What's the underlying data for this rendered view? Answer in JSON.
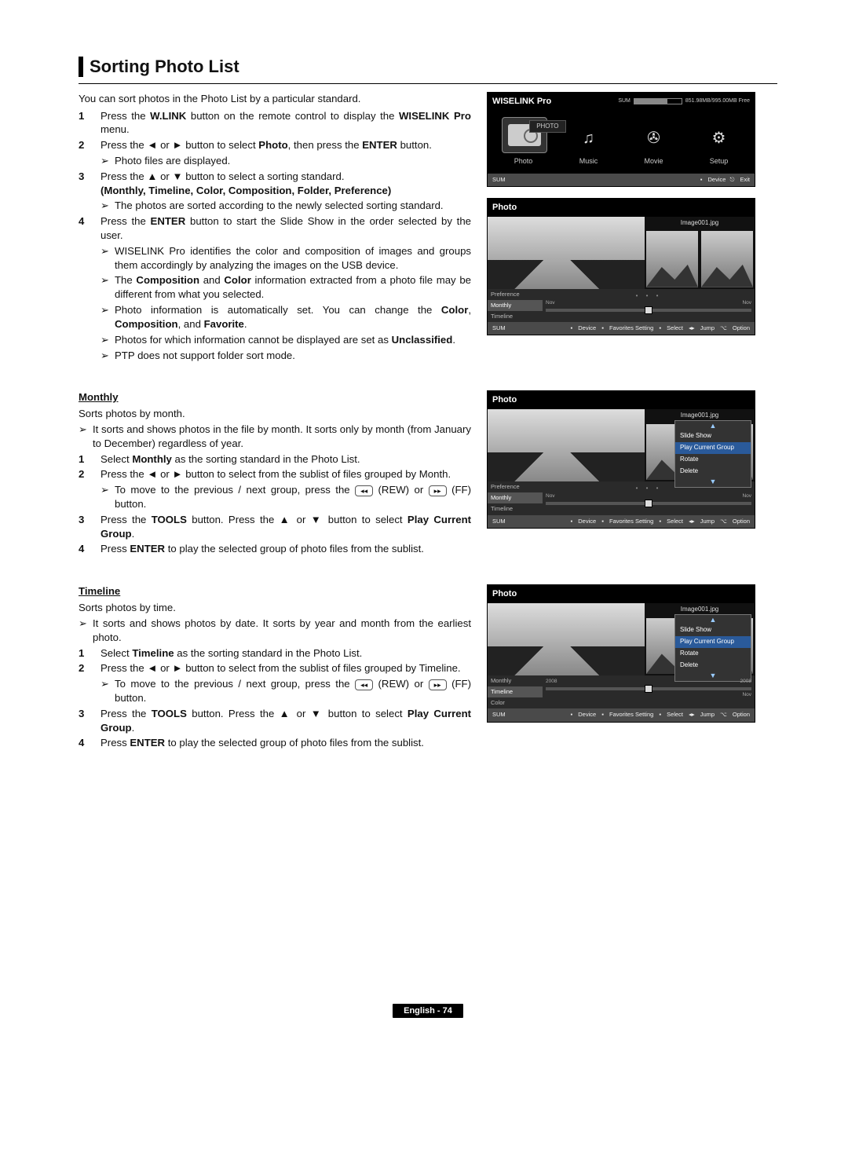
{
  "title": "Sorting Photo List",
  "intro": "You can sort photos in the Photo List by a particular standard.",
  "step1": {
    "num": "1",
    "a": "Press the ",
    "b": "W.LINK",
    "c": " button on the remote control to display the ",
    "d": "WISELINK Pro",
    "e": " menu."
  },
  "step2": {
    "num": "2",
    "a": "Press the ◄ or ► button to select ",
    "b": "Photo",
    "c": ", then press the ",
    "d": "ENTER",
    "e": " button."
  },
  "step2_note": "Photo files are displayed.",
  "step3": {
    "num": "3",
    "a": "Press the ▲ or ▼ button to select a sorting standard.",
    "b": "(Monthly, Timeline, Color, Composition, Folder, Preference)"
  },
  "step3_note": "The photos are sorted according to the newly selected sorting standard.",
  "step4": {
    "num": "4",
    "a": "Press the ",
    "b": "ENTER",
    "c": " button to start the Slide Show in the order selected by the user."
  },
  "step4_notes": {
    "n1": "WISELINK Pro identifies the color and composition of images and groups them accordingly by analyzing the images on the USB device.",
    "n2a": "The ",
    "n2b": "Composition",
    "n2c": " and ",
    "n2d": "Color",
    "n2e": " information extracted from a photo file may be different from what you selected.",
    "n3a": "Photo information is automatically set. You can change the ",
    "n3b": "Color",
    "n3c": ", ",
    "n3d": "Composition",
    "n3e": ", and ",
    "n3f": "Favorite",
    "n3g": ".",
    "n4a": "Photos for which information cannot be displayed are set as ",
    "n4b": "Unclassified",
    "n4c": ".",
    "n5": "PTP does not support folder sort mode."
  },
  "monthly": {
    "head": "Monthly",
    "desc": "Sorts photos by month.",
    "note": "It sorts and shows photos in the file by month. It sorts only by month (from January to December) regardless of year.",
    "s1": {
      "num": "1",
      "a": "Select ",
      "b": "Monthly",
      "c": " as the sorting standard in the Photo List."
    },
    "s2": {
      "num": "2",
      "a": "Press the ◄ or ► button to select from the sublist of files grouped by Month."
    },
    "s2_note_a": "To move to the previous / next group, press the ",
    "s2_note_b": " (REW) or ",
    "s2_note_c": " (FF) button.",
    "s3": {
      "num": "3",
      "a": "Press the ",
      "b": "TOOLS",
      "c": " button. Press the ▲ or ▼ button to select ",
      "d": "Play Current Group",
      "e": "."
    },
    "s4": {
      "num": "4",
      "a": "Press ",
      "b": "ENTER",
      "c": " to play the selected group of photo files from the sublist."
    }
  },
  "timeline": {
    "head": "Timeline",
    "desc": "Sorts photos by time.",
    "note": "It sorts and shows photos by date. It sorts by year and month from the earliest photo.",
    "s1": {
      "num": "1",
      "a": "Select ",
      "b": "Timeline",
      "c": " as the sorting standard in the Photo List."
    },
    "s2": {
      "num": "2",
      "a": "Press the ◄ or ► button to select from the sublist of files grouped by Timeline."
    },
    "s2_note_a": "To move to the previous / next group, press the ",
    "s2_note_b": " (REW) or ",
    "s2_note_c": " (FF) button.",
    "s3": {
      "num": "3",
      "a": "Press the ",
      "b": "TOOLS",
      "c": " button. Press the ▲ or ▼ button to select ",
      "d": "Play Current Group",
      "e": "."
    },
    "s4": {
      "num": "4",
      "a": "Press ",
      "b": "ENTER",
      "c": " to play the selected group of photo files from the sublist."
    }
  },
  "shots": {
    "wiselink": {
      "title": "WISELINK Pro",
      "sum": "SUM",
      "free": "851.98MB/995.00MB Free",
      "badge": "PHOTO",
      "items": [
        "Photo",
        "Music",
        "Movie",
        "Setup"
      ],
      "foot_l": "SUM",
      "foot_r1": "Device",
      "foot_r2": "Exit"
    },
    "photo": {
      "title": "Photo",
      "caption": "Image001.jpg",
      "tabs": [
        "Preference",
        "Monthly",
        "Timeline"
      ],
      "active": 1,
      "lab_l": "Nov",
      "lab_r": "Nov",
      "foot_l": "SUM",
      "foot_legend": [
        "Device",
        "Favorites Setting",
        "Select",
        "Jump",
        "Option"
      ]
    },
    "tools": {
      "menu": [
        "Slide Show",
        "Play Current Group",
        "Rotate",
        "Delete"
      ],
      "highlight": 1
    },
    "timeline_tabs": [
      "Monthly",
      "Timeline",
      "Color"
    ],
    "timeline_active": 1,
    "timeline_lab_l": "2008",
    "timeline_lab_r": "2008",
    "timeline_sub_r": "Nov"
  },
  "rewind_glyph": "◂◂",
  "ff_glyph": "▸▸",
  "note_glyph": "➢",
  "footer": "English - 74"
}
